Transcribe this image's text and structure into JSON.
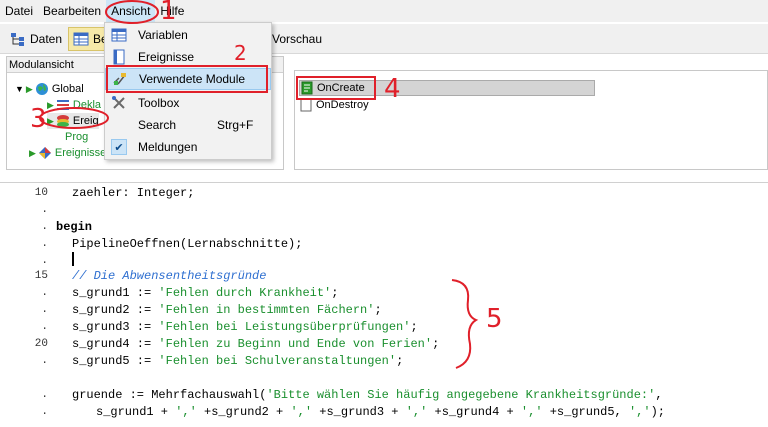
{
  "menubar": {
    "items": [
      {
        "label": "Datei",
        "open": false
      },
      {
        "label": "Bearbeiten",
        "open": false
      },
      {
        "label": "Ansicht",
        "open": true
      },
      {
        "label": "Hilfe",
        "open": false
      }
    ]
  },
  "toolbar": {
    "daten_label": "Daten",
    "bearbeiten_label": "Be",
    "vorschau_label": "Vorschau"
  },
  "module_panel": {
    "title": "Modulansicht",
    "tree": {
      "global": "Global",
      "deklarationen": "Dekla",
      "ereignisse": "Ereig",
      "programm": "Prog",
      "ereignisse_root": "Ereignisse"
    }
  },
  "dropdown": {
    "items": [
      {
        "label": "Variablen",
        "icon": "table-icon",
        "shortcut": ""
      },
      {
        "label": "Ereignisse",
        "icon": "page-icon",
        "shortcut": ""
      },
      {
        "label": "Verwendete Module",
        "icon": "modules-icon",
        "shortcut": ""
      },
      {
        "label": "Toolbox",
        "icon": "tools-icon",
        "shortcut": ""
      },
      {
        "label": "Search",
        "icon": "",
        "shortcut": "Strg+F"
      },
      {
        "label": "Meldungen",
        "icon": "check-icon",
        "shortcut": ""
      }
    ]
  },
  "events": {
    "items": [
      {
        "label": "OnCreate",
        "selected": true
      },
      {
        "label": "OnDestroy",
        "selected": false
      }
    ]
  },
  "editor": {
    "line_numbers": [
      "10",
      ".",
      ".",
      ".",
      ".",
      "15",
      ".",
      ".",
      ".",
      "20",
      ".",
      ".",
      "."
    ],
    "lines": {
      "l1": "zaehler: Integer;",
      "l2": "begin",
      "l3": "PipelineOeffnen(Lernabschnitte);",
      "l4": "// Die Abwensentheitsgründe",
      "l5a": "s_grund1 := ",
      "l5b": "'Fehlen durch Krankheit'",
      "l5c": ";",
      "l6a": "s_grund2 := ",
      "l6b": "'Fehlen in bestimmten Fächern'",
      "l6c": ";",
      "l7a": "s_grund3 := ",
      "l7b": "'Fehlen bei Leistungsüberprüfungen'",
      "l7c": ";",
      "l8a": "s_grund4 := ",
      "l8b": "'Fehlen zu Beginn und Ende von Ferien'",
      "l8c": ";",
      "l9a": "s_grund5 := ",
      "l9b": "'Fehlen bei Schulveranstaltungen'",
      "l9c": ";",
      "l10a": "gruende := Mehrfachauswahl(",
      "l10b": "'Bitte wählen Sie häufig angegebene Krankheitsgründe:'",
      "l10c": ",",
      "l11a": "s_grund1 + ",
      "l11b": "','",
      "l11c": " +s_grund2 + ",
      "l11d": "','",
      "l11e": " +s_grund3 + ",
      "l11f": "','",
      "l11g": " +s_grund4 + ",
      "l11h": "','",
      "l11i": " +s_grund5, ",
      "l11j": "','",
      "l11k": ");"
    }
  },
  "annotations": {
    "n1": "1",
    "n2": "2",
    "n3": "3",
    "n4": "4",
    "n5": "5",
    "color": "#e0202a"
  }
}
